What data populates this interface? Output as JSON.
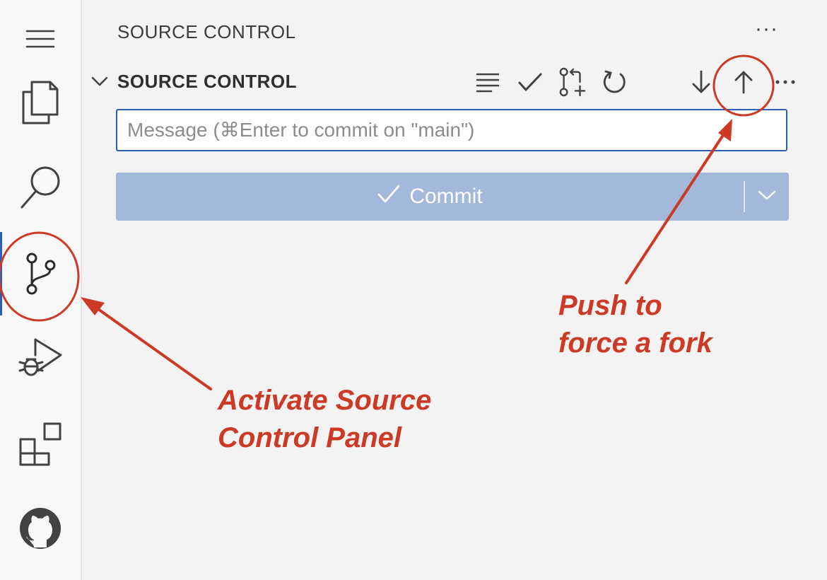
{
  "activity_bar": {
    "items": [
      "menu-icon",
      "explorer-icon",
      "search-icon",
      "source-control-icon",
      "run-debug-icon",
      "extensions-icon",
      "github-icon"
    ],
    "active": "source-control-icon"
  },
  "panel": {
    "title": "SOURCE CONTROL",
    "more_label": "···",
    "section_title": "SOURCE CONTROL",
    "toolbar_icons": [
      "view-as-tree-icon",
      "commit-check-icon",
      "create-pull-request-icon",
      "refresh-icon",
      "pull-arrow-down-icon",
      "push-arrow-up-icon",
      "more-actions-icon"
    ]
  },
  "commit": {
    "message_placeholder": "Message (⌘Enter to commit on \"main\")",
    "message_value": "",
    "button_label": "Commit"
  },
  "annotations": {
    "push_line1": "Push to",
    "push_line2": "force a fork",
    "activate_line1": "Activate Source",
    "activate_line2": "Control Panel"
  },
  "colors": {
    "annotation": "#cc3a26",
    "accent": "#2c5fb8",
    "commit_button": "#a3b9dc",
    "icon": "#424242"
  }
}
